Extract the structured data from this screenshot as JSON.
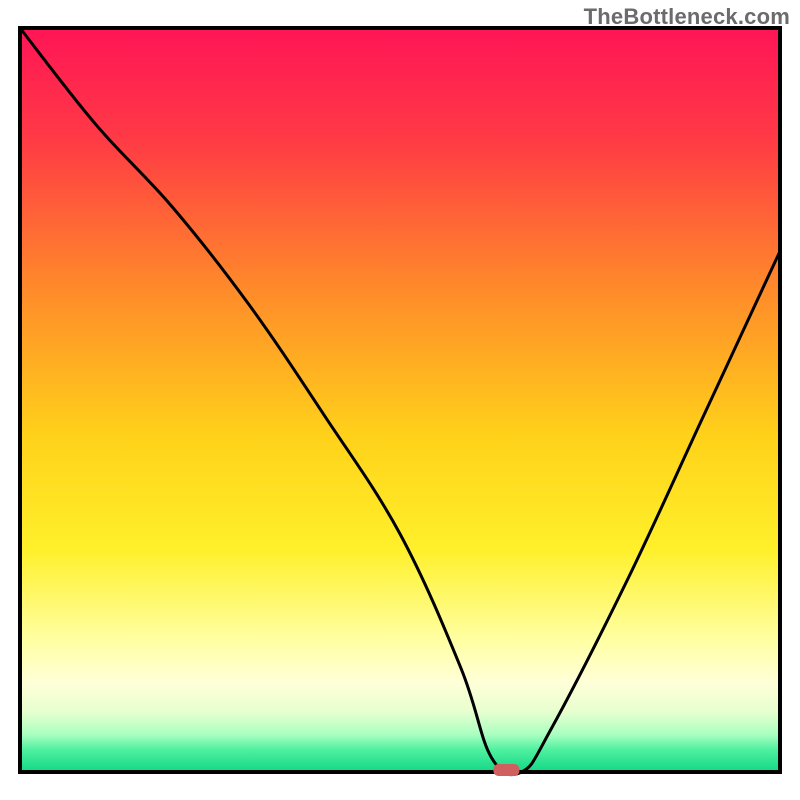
{
  "watermark": "TheBottleneck.com",
  "chart_data": {
    "type": "line",
    "title": "",
    "xlabel": "",
    "ylabel": "",
    "xlim": [
      0,
      100
    ],
    "ylim": [
      0,
      100
    ],
    "series": [
      {
        "name": "bottleneck-curve",
        "x": [
          0,
          10,
          20,
          30,
          40,
          50,
          58,
          62,
          66,
          70,
          80,
          90,
          100
        ],
        "y": [
          100,
          87,
          76,
          63,
          48,
          32,
          14,
          2,
          0,
          6,
          26,
          48,
          70
        ]
      }
    ],
    "marker": {
      "x": 64,
      "y": 0,
      "color": "#d06060"
    },
    "background_gradient": {
      "stops": [
        {
          "offset": 0.0,
          "color": "#ff1556"
        },
        {
          "offset": 0.15,
          "color": "#ff3a45"
        },
        {
          "offset": 0.35,
          "color": "#ff8a2a"
        },
        {
          "offset": 0.55,
          "color": "#ffd21a"
        },
        {
          "offset": 0.7,
          "color": "#fff02a"
        },
        {
          "offset": 0.82,
          "color": "#ffffa0"
        },
        {
          "offset": 0.88,
          "color": "#ffffd8"
        },
        {
          "offset": 0.92,
          "color": "#e6ffcf"
        },
        {
          "offset": 0.95,
          "color": "#a8ffc0"
        },
        {
          "offset": 0.97,
          "color": "#50f0a0"
        },
        {
          "offset": 1.0,
          "color": "#10d885"
        }
      ]
    },
    "grid": false,
    "legend": false
  }
}
